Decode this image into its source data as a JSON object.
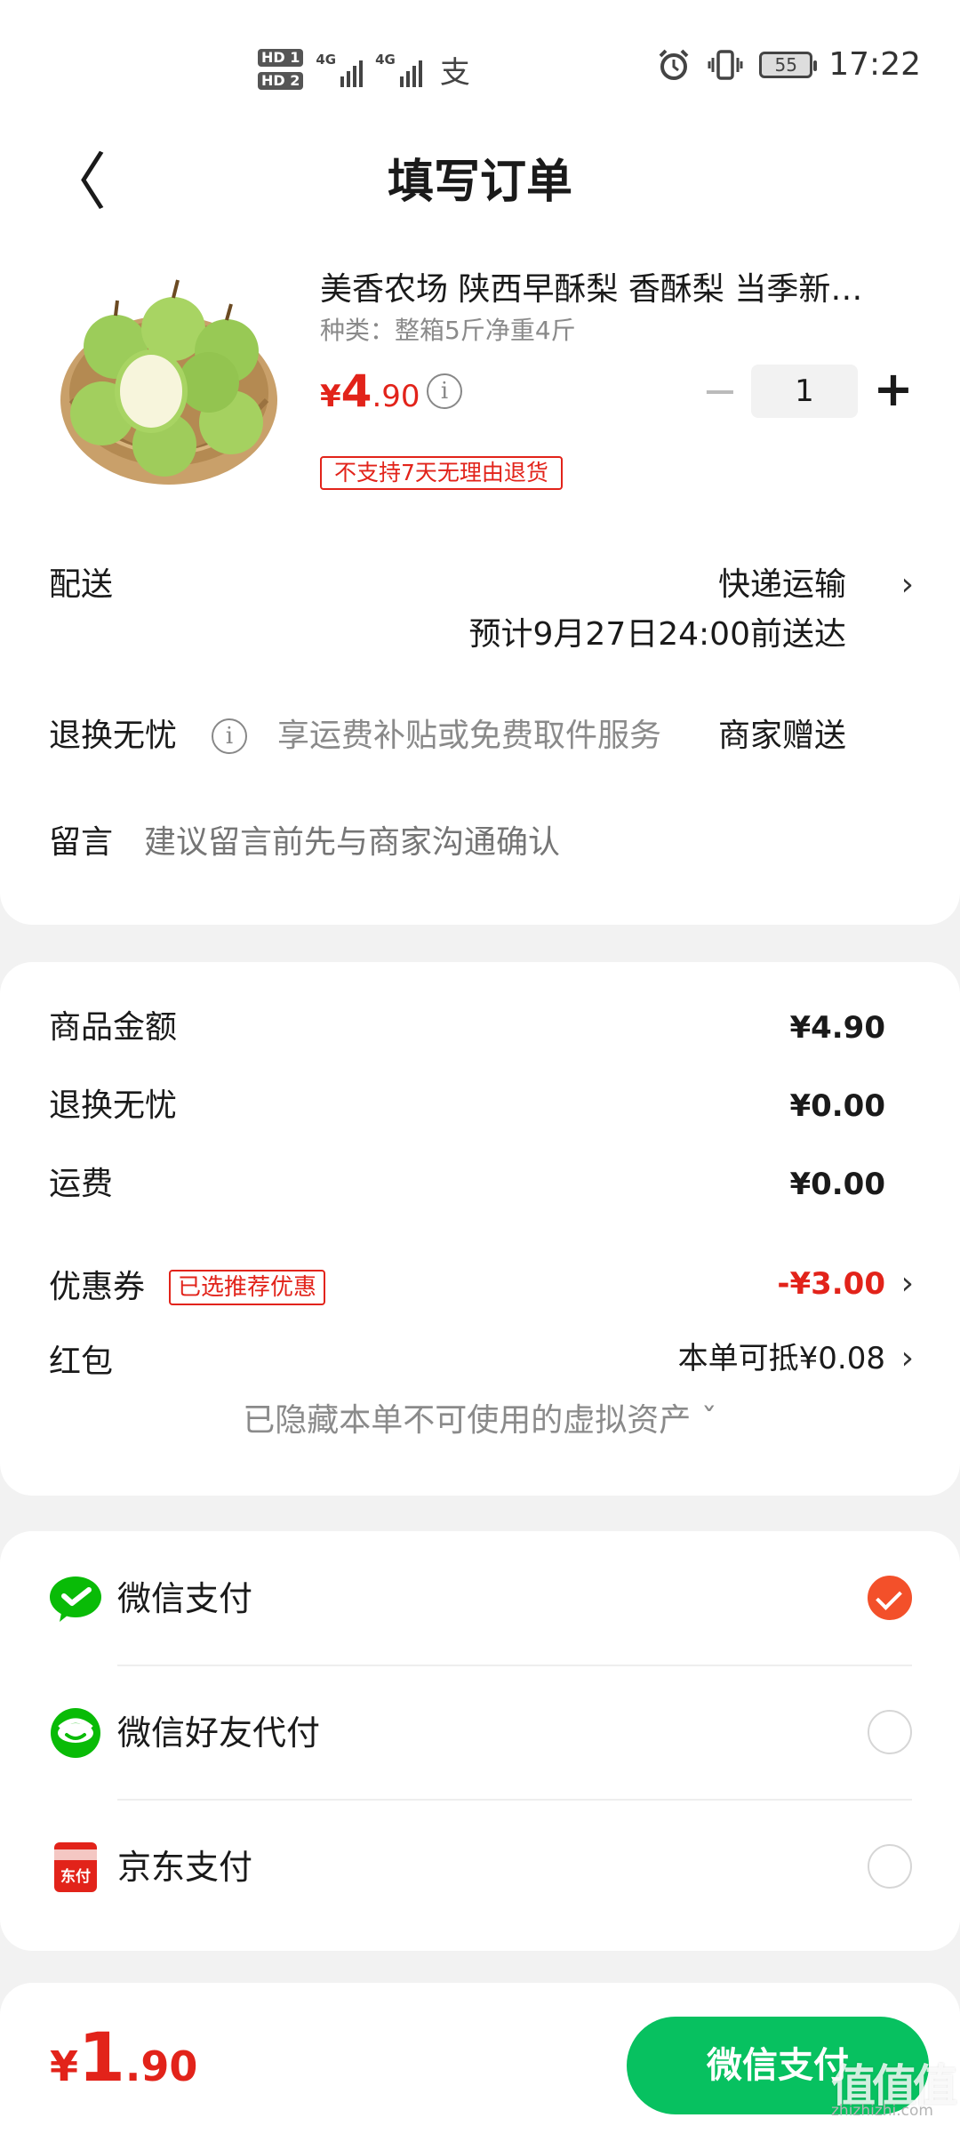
{
  "status_bar": {
    "hd1": "HD 1",
    "hd2": "HD 2",
    "net1": "4G",
    "net2": "4G",
    "alipay_glyph": "支",
    "battery": "55",
    "time": "17:22",
    "icons": [
      "alarm-icon",
      "vibrate-icon",
      "battery-icon",
      "signal-icon",
      "alipay-icon"
    ]
  },
  "header": {
    "back_glyph": "〈",
    "title": "填写订单"
  },
  "product": {
    "title": "美香农场 陕西早酥梨 香酥梨 当季新…",
    "spec": "种类：整箱5斤净重4斤",
    "price_currency": "¥",
    "price_int": "4",
    "price_dec": ".90",
    "quantity": "1",
    "minus_glyph": "−",
    "plus_glyph": "+",
    "no_return_tag": "不支持7天无理由退货"
  },
  "delivery": {
    "label": "配送",
    "method": "快递运输",
    "eta": "预计9月27日24:00前送达",
    "chevron": "›"
  },
  "worry_free": {
    "label": "退换无忧",
    "desc": "享运费补贴或免费取件服务",
    "value": "商家赠送"
  },
  "message": {
    "label": "留言",
    "placeholder": "建议留言前先与商家沟通确认"
  },
  "summary": {
    "goods_label": "商品金额",
    "goods_value": "¥4.90",
    "worry_label": "退换无忧",
    "worry_value": "¥0.00",
    "shipping_label": "运费",
    "shipping_value": "¥0.00",
    "coupon_label": "优惠券",
    "coupon_badge": "已选推荐优惠",
    "coupon_value": "-¥3.00",
    "hongbao_label": "红包",
    "hongbao_value": "本单可抵¥0.08",
    "hidden_assets": "已隐藏本单不可使用的虚拟资产 ˇ"
  },
  "payment": {
    "methods": [
      {
        "label": "微信支付",
        "icon": "wechat-pay-icon",
        "selected": true
      },
      {
        "label": "微信好友代付",
        "icon": "wechat-friend-pay-icon",
        "selected": false
      },
      {
        "label": "京东支付",
        "icon": "jd-pay-icon",
        "selected": false
      }
    ],
    "jd_icon_text": "东付"
  },
  "bottom": {
    "total_currency": "¥",
    "total_int": "1",
    "total_dec": ".90",
    "pay_button": "微信支付"
  },
  "watermark": {
    "main": "值值值",
    "sub": "zhizhizhi.com"
  },
  "colors": {
    "accent_red": "#e2231a",
    "wechat_green": "#07c160",
    "radio_selected": "#f3502a"
  }
}
